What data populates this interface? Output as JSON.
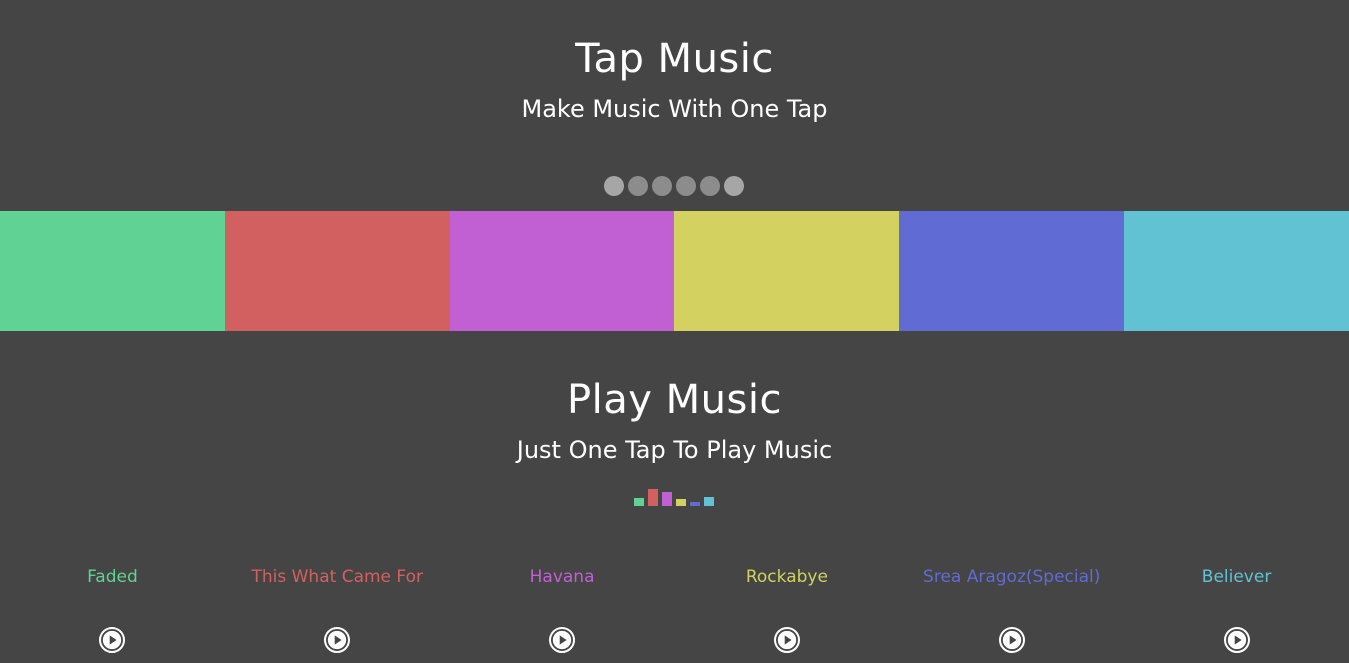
{
  "header": {
    "title": "Tap Music",
    "subtitle": "Make Music With One Tap"
  },
  "dots": [
    {
      "icon": "dot-indicator"
    },
    {
      "icon": "dot-indicator"
    },
    {
      "icon": "dot-indicator"
    },
    {
      "icon": "dot-indicator"
    },
    {
      "icon": "dot-indicator"
    },
    {
      "icon": "dot-indicator"
    }
  ],
  "pads": [
    {
      "color": "#60d394"
    },
    {
      "color": "#d36060"
    },
    {
      "color": "#c060d3"
    },
    {
      "color": "#d3d160"
    },
    {
      "color": "#606bd3"
    },
    {
      "color": "#60c2d3"
    }
  ],
  "play_section": {
    "title": "Play Music",
    "subtitle": "Just One Tap To Play Music"
  },
  "songs": [
    {
      "name": "Faded",
      "color": "#60d394",
      "icon": "play-icon"
    },
    {
      "name": "This What Came For",
      "color": "#d36060",
      "icon": "play-icon"
    },
    {
      "name": "Havana",
      "color": "#c060d3",
      "icon": "play-icon"
    },
    {
      "name": "Rockabye",
      "color": "#d3d160",
      "icon": "play-icon"
    },
    {
      "name": "Srea Aragoz(Special)",
      "color": "#606bd3",
      "icon": "play-icon"
    },
    {
      "name": "Believer",
      "color": "#60c2d3",
      "icon": "play-icon"
    }
  ]
}
